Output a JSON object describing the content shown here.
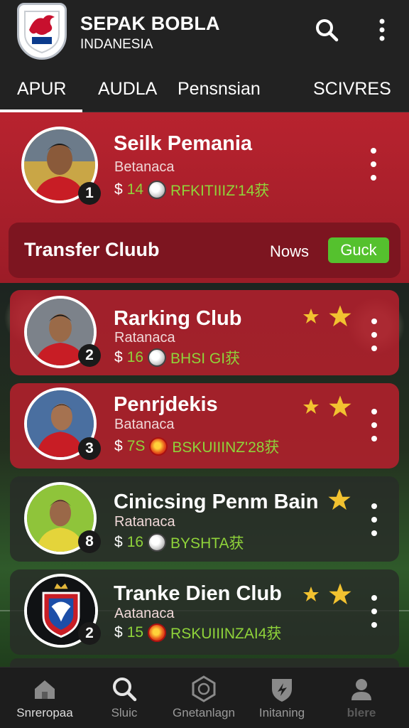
{
  "app": {
    "title": "SEPAK BOBLA",
    "subtitle": "INDANESIA"
  },
  "colors": {
    "accent_red": "#b8232f",
    "dark_red": "#7d1520",
    "stat_green": "#8fd33a",
    "button_green": "#55c12e",
    "star_gold": "#f2c230"
  },
  "header_icons": [
    "search-icon",
    "more-vert-icon"
  ],
  "tabs": [
    {
      "label": "APUR",
      "active": true
    },
    {
      "label": "AUDLA"
    },
    {
      "label": "Pensnsian"
    },
    {
      "label": "SCIVRES"
    }
  ],
  "featured": {
    "name": "Seilk Pemania",
    "team": "Betanaca",
    "rank": "1",
    "stat_prefix": "$",
    "stat_value": "14",
    "stat_extra": "RFKITIIIZ'14获"
  },
  "transfer": {
    "title": "Transfer Cluub",
    "news": "Nows",
    "button": "Guck"
  },
  "players": [
    {
      "name": "Rarking Club",
      "team": "Ratanaca",
      "rank": "2",
      "prefix": "$",
      "value": "16",
      "extra": "BHSI GI获",
      "stars": 2
    },
    {
      "name": "Penrjdekis",
      "team": "Batanaca",
      "rank": "3",
      "prefix": "$",
      "value": "7S",
      "extra": "BSKUIIINZ'28获",
      "stars": 2
    },
    {
      "name": "Cinicsing Penm Bain",
      "team": "Ratanaca",
      "rank": "8",
      "prefix": "$",
      "value": "16",
      "extra": "BYSHTA获",
      "stars": 1
    },
    {
      "name": "Tranke Dien Club",
      "team": "Aatanaca",
      "rank": "2",
      "prefix": "$",
      "value": "15",
      "extra": "RSKUIIINZAI4获",
      "stars": 2
    }
  ],
  "bottom_nav": [
    {
      "label": "Snreropaa",
      "icon": "home-icon",
      "active": true
    },
    {
      "label": "Sluic",
      "icon": "search-icon"
    },
    {
      "label": "Gnetanlagn",
      "icon": "ball-badge-icon"
    },
    {
      "label": "Initaning",
      "icon": "shield-icon"
    },
    {
      "label": "blere",
      "icon": "profile-icon"
    }
  ]
}
